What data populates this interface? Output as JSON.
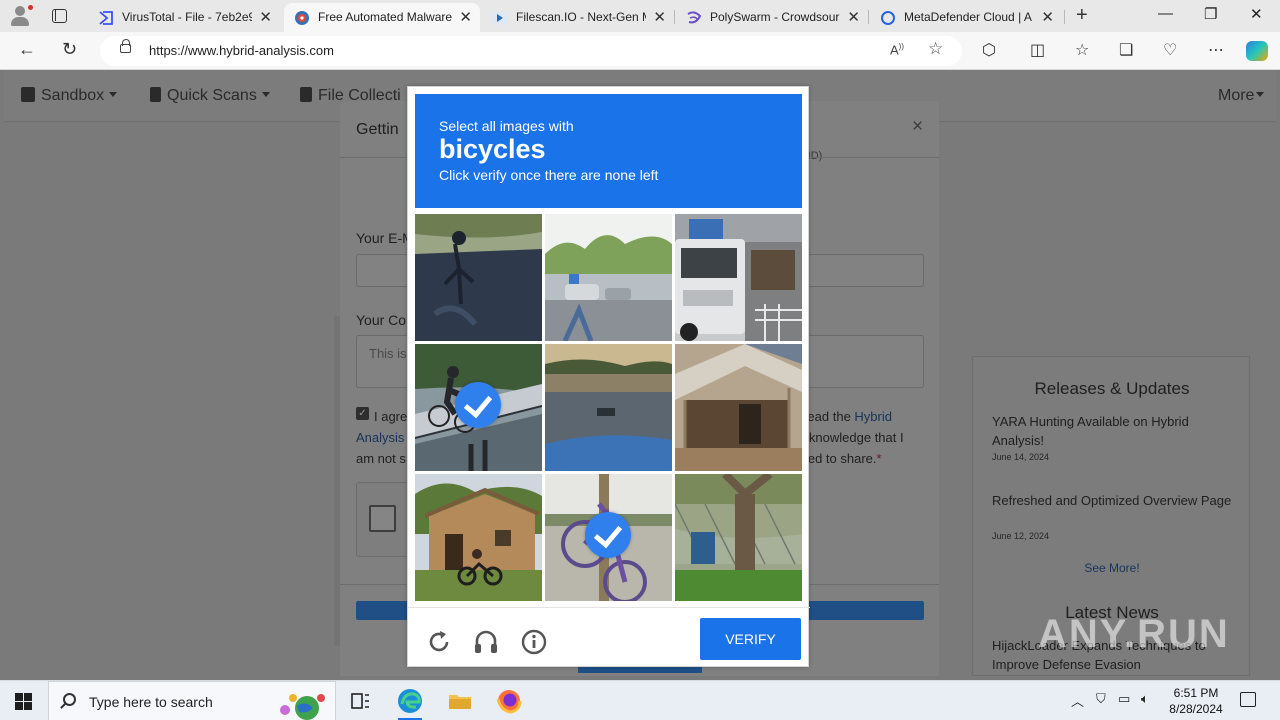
{
  "browser": {
    "tabs": [
      {
        "title": "VirusTotal - File - 7eb2e9",
        "favicon": "virustotal-icon",
        "active": false
      },
      {
        "title": "Free Automated Malware",
        "favicon": "hybrid-analysis-icon",
        "active": true
      },
      {
        "title": "Filescan.IO - Next-Gen M",
        "favicon": "filescan-icon",
        "active": false
      },
      {
        "title": "PolySwarm - Crowdsour",
        "favicon": "polyswarm-icon",
        "active": false
      },
      {
        "title": "MetaDefender Cloud | A",
        "favicon": "metadefender-icon",
        "active": false
      }
    ],
    "url": "https://www.hybrid-analysis.com"
  },
  "site": {
    "nav": {
      "sandbox": "Sandbox",
      "quick_scans": "Quick Scans",
      "file_collections": "File Collecti",
      "more": "More"
    },
    "modal": {
      "title_partial": "Gettin",
      "email_label_partial": "Your E-M",
      "comment_label_partial": "Your Co",
      "comment_placeholder_partial": "This is",
      "id_fragment": "(ID)",
      "agree_line1_left": "I agre",
      "agree_line1_right": "e read the ",
      "agree_link_right": "Hybrid",
      "agree_link_left": "Analysis",
      "agree_line2_right": "cknowledge that I",
      "agree_line3_left": "am not s",
      "agree_line3_right": "ed to share.",
      "required_mark": "*"
    },
    "sidebar": {
      "releases_heading": "Releases & Updates",
      "releases": [
        {
          "title": "YARA Hunting Available on Hybrid Analysis!",
          "date": "June 14, 2024"
        },
        {
          "title": "Refreshed and Optimized Overview Page",
          "date": "June 12, 2024"
        }
      ],
      "see_more": "See More!",
      "news_heading": "Latest News",
      "news": [
        {
          "title": "HijackLoader Expands Techniques to Improve Defense Evasion"
        }
      ]
    }
  },
  "captcha": {
    "prompt_line1": "Select all images with",
    "prompt_target": "bicycles",
    "prompt_line3": "Click verify once there are none left",
    "tiles": [
      {
        "scene": "shadow-on-asphalt",
        "selected": false
      },
      {
        "scene": "parking-lot",
        "selected": false
      },
      {
        "scene": "truck",
        "selected": false
      },
      {
        "scene": "person-on-bicycle-bridge",
        "selected": true
      },
      {
        "scene": "street-with-vehicle",
        "selected": false
      },
      {
        "scene": "covered-patio",
        "selected": false
      },
      {
        "scene": "house-with-motorcycle",
        "selected": false
      },
      {
        "scene": "bicycle-on-pole",
        "selected": true
      },
      {
        "scene": "tree-and-fence",
        "selected": false
      }
    ],
    "footer_icons": [
      "refresh-icon",
      "audio-icon",
      "info-icon"
    ],
    "verify_label": "VERIFY"
  },
  "watermark": "ANY.RUN",
  "taskbar": {
    "search_placeholder": "Type here to search",
    "time": "6:51 PM",
    "date": "8/28/2024"
  },
  "colors": {
    "accent": "#1a73e8",
    "select_badge": "#2f80ed"
  }
}
